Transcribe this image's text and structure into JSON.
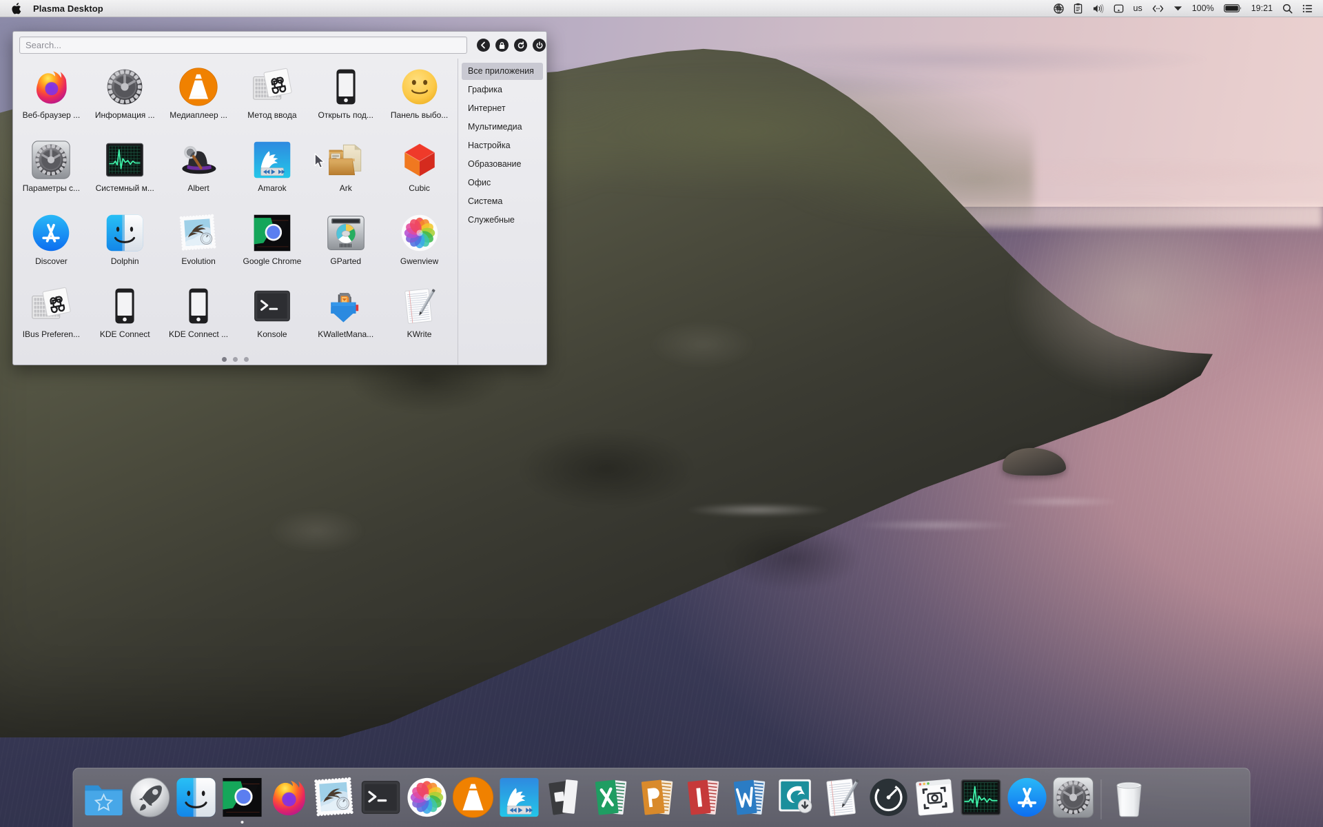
{
  "menubar": {
    "apple_logo": "apple-logo",
    "title": "Plasma Desktop",
    "tray": [
      {
        "name": "network-globe-icon",
        "label": ""
      },
      {
        "name": "clipboard-icon",
        "label": ""
      },
      {
        "name": "volume-icon",
        "label": ""
      },
      {
        "name": "disk-icon",
        "label": ""
      },
      {
        "name": "keyboard-layout-label",
        "label": "us"
      },
      {
        "name": "keyboard-switch-icon",
        "label": ""
      },
      {
        "name": "dropdown-caret-icon",
        "label": ""
      },
      {
        "name": "battery-percent-label",
        "label": "100%"
      },
      {
        "name": "battery-icon",
        "label": ""
      },
      {
        "name": "clock-label",
        "label": "19:21"
      },
      {
        "name": "spotlight-search-icon",
        "label": ""
      },
      {
        "name": "control-center-icon",
        "label": ""
      }
    ]
  },
  "launcher": {
    "search": {
      "placeholder": "Search...",
      "value": ""
    },
    "buttons": [
      {
        "name": "back-button",
        "icon": "chevron-left-icon"
      },
      {
        "name": "lock-button",
        "icon": "lock-icon"
      },
      {
        "name": "restart-button",
        "icon": "refresh-icon"
      },
      {
        "name": "power-button",
        "icon": "power-icon"
      }
    ],
    "apps": [
      {
        "label": "Веб-браузер ...",
        "icon": "firefox-icon"
      },
      {
        "label": "Информация ...",
        "icon": "system-info-gear-icon"
      },
      {
        "label": "Медиаплеер ...",
        "icon": "vlc-cone-icon"
      },
      {
        "label": "Метод ввода",
        "icon": "input-method-keyboard-icon"
      },
      {
        "label": "Открыть под...",
        "icon": "phone-icon"
      },
      {
        "label": "Панель выбо...",
        "icon": "emoji-smiley-icon"
      },
      {
        "label": "Параметры с...",
        "icon": "system-settings-gear-icon"
      },
      {
        "label": "Системный м...",
        "icon": "system-monitor-icon"
      },
      {
        "label": "Albert",
        "icon": "albert-hat-icon"
      },
      {
        "label": "Amarok",
        "icon": "amarok-wolf-icon"
      },
      {
        "label": "Ark",
        "icon": "ark-archive-icon"
      },
      {
        "label": "Cubic",
        "icon": "cubic-icon"
      },
      {
        "label": "Discover",
        "icon": "discover-appstore-icon"
      },
      {
        "label": "Dolphin",
        "icon": "dolphin-finder-icon"
      },
      {
        "label": "Evolution",
        "icon": "evolution-stamp-icon"
      },
      {
        "label": "Google Chrome",
        "icon": "chrome-icon"
      },
      {
        "label": "GParted",
        "icon": "gparted-disk-icon"
      },
      {
        "label": "Gwenview",
        "icon": "gwenview-photos-icon"
      },
      {
        "label": "IBus Preferen...",
        "icon": "ibus-keyboard-icon"
      },
      {
        "label": "KDE Connect",
        "icon": "kdeconnect-phone-icon"
      },
      {
        "label": "KDE Connect ...",
        "icon": "kdeconnect-phone-icon"
      },
      {
        "label": "Konsole",
        "icon": "konsole-terminal-icon"
      },
      {
        "label": "KWalletMana...",
        "icon": "kwallet-icon"
      },
      {
        "label": "KWrite",
        "icon": "kwrite-notes-icon"
      }
    ],
    "pages": {
      "count": 3,
      "active": 1
    },
    "categories": [
      {
        "label": "Все приложения",
        "selected": true
      },
      {
        "label": "Графика",
        "selected": false
      },
      {
        "label": "Интернет",
        "selected": false
      },
      {
        "label": "Мультимедиа",
        "selected": false
      },
      {
        "label": "Настройка",
        "selected": false
      },
      {
        "label": "Образование",
        "selected": false
      },
      {
        "label": "Офис",
        "selected": false
      },
      {
        "label": "Система",
        "selected": false
      },
      {
        "label": "Служебные",
        "selected": false
      }
    ]
  },
  "dock": {
    "items": [
      {
        "name": "dock-item-favorites-folder",
        "icon": "folder-star-icon",
        "running": false
      },
      {
        "name": "dock-item-launchpad",
        "icon": "launchpad-rocket-icon",
        "running": false
      },
      {
        "name": "dock-item-dolphin",
        "icon": "dolphin-finder-icon",
        "running": false
      },
      {
        "name": "dock-item-chrome",
        "icon": "chrome-icon",
        "running": true
      },
      {
        "name": "dock-item-firefox",
        "icon": "firefox-icon",
        "running": false
      },
      {
        "name": "dock-item-evolution",
        "icon": "evolution-stamp-icon",
        "running": false
      },
      {
        "name": "dock-item-konsole",
        "icon": "konsole-terminal-icon",
        "running": false
      },
      {
        "name": "dock-item-gwenview",
        "icon": "gwenview-photos-icon",
        "running": false
      },
      {
        "name": "dock-item-vlc",
        "icon": "vlc-cone-icon",
        "running": false
      },
      {
        "name": "dock-item-amarok",
        "icon": "amarok-wolf-icon",
        "running": false
      },
      {
        "name": "dock-item-keynote",
        "icon": "office-powerpoint-icon",
        "running": false
      },
      {
        "name": "dock-item-excel",
        "icon": "office-excel-icon",
        "running": false
      },
      {
        "name": "dock-item-publisher",
        "icon": "office-publisher-icon",
        "running": false
      },
      {
        "name": "dock-item-infopath",
        "icon": "office-infopath-icon",
        "running": false
      },
      {
        "name": "dock-item-word",
        "icon": "office-word-icon",
        "running": false
      },
      {
        "name": "dock-item-bittorrent",
        "icon": "bittorrent-icon",
        "running": false
      },
      {
        "name": "dock-item-kwrite",
        "icon": "kwrite-notes-icon",
        "running": false
      },
      {
        "name": "dock-item-activity-monitor",
        "icon": "speedometer-icon",
        "running": false
      },
      {
        "name": "dock-item-screenshot",
        "icon": "screenshot-icon",
        "running": false
      },
      {
        "name": "dock-item-system-monitor",
        "icon": "system-monitor-icon",
        "running": false
      },
      {
        "name": "dock-item-discover",
        "icon": "discover-appstore-icon",
        "running": false
      },
      {
        "name": "dock-item-system-settings",
        "icon": "system-settings-gear-icon",
        "running": false
      },
      {
        "name": "dock-item-trash",
        "icon": "trash-icon",
        "running": false
      }
    ]
  },
  "colors": {
    "menubar_bg": "#e9e9eb",
    "launcher_bg": "#e7e7ec",
    "category_selected": "#c9c9d2",
    "dock_bg": "#77777d",
    "accent_blue": "#1a8cff",
    "wallpaper_sky": "#b5aac0",
    "wallpaper_sea_dark": "#3a3a58",
    "wallpaper_sea_pink": "#c8a0a8"
  }
}
